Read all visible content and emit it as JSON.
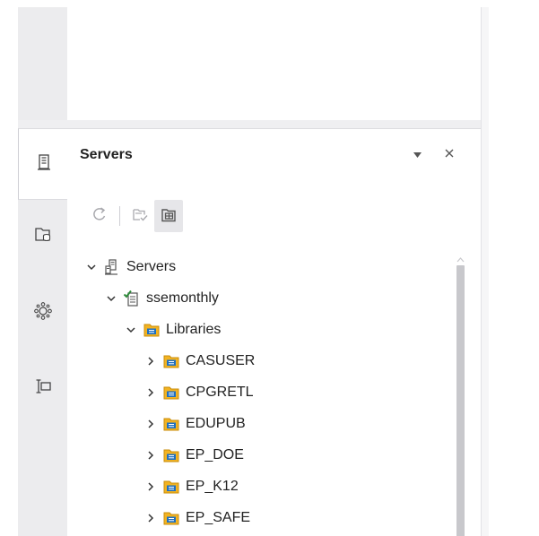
{
  "panel": {
    "title": "Servers",
    "menu_icon": "dropdown-triangle-icon",
    "close_icon": "close-icon"
  },
  "sidebar": {
    "items": [
      {
        "icon": "server-icon",
        "active": true
      },
      {
        "icon": "library-folder-icon",
        "active": false
      },
      {
        "icon": "snippets-network-icon",
        "active": false
      },
      {
        "icon": "text-field-icon",
        "active": false
      }
    ]
  },
  "toolbar": {
    "buttons": [
      {
        "icon": "refresh-icon",
        "enabled": false
      },
      {
        "icon": "disconnect-icon",
        "enabled": false
      },
      {
        "icon": "library-properties-icon",
        "enabled": true,
        "pressed": true
      }
    ]
  },
  "tree": {
    "servers": "Servers",
    "server": "ssemonthly",
    "libraries": "Libraries",
    "items": [
      "CASUSER",
      "CPGRETL",
      "EDUPUB",
      "EP_DOE",
      "EP_K12",
      "EP_SAFE"
    ]
  },
  "colors": {
    "accent_blue": "#1f6fbf",
    "library_yellow": "#f2b322",
    "connected_green": "#2e8b3a"
  }
}
